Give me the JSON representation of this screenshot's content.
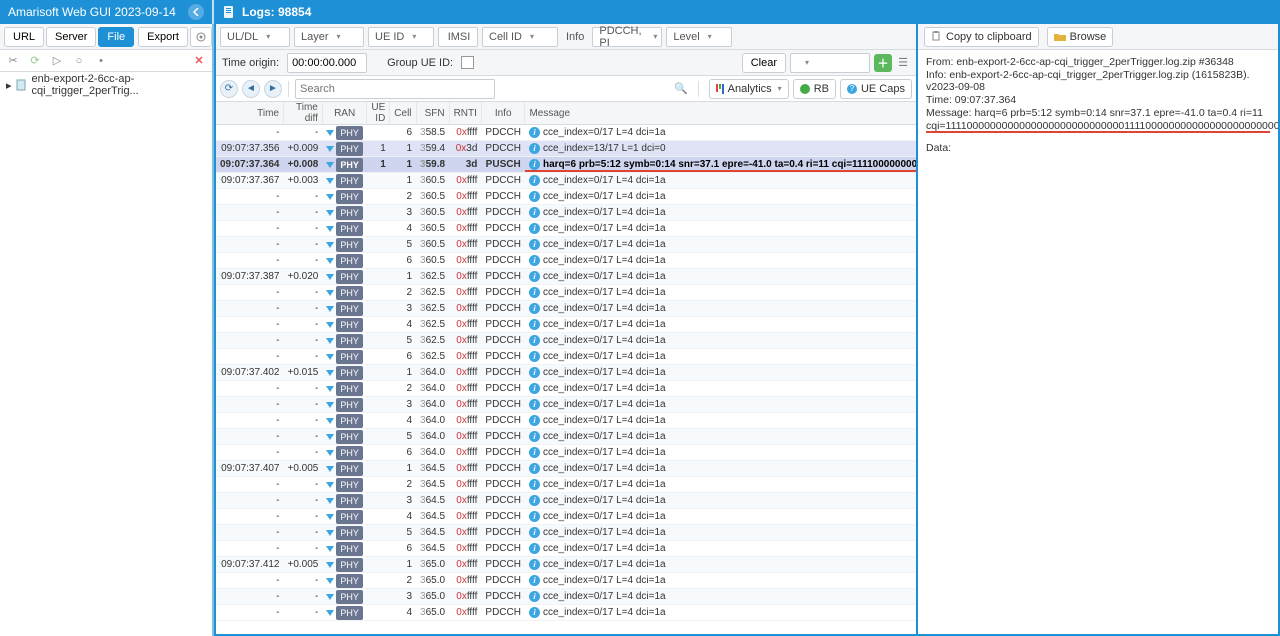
{
  "app_title": "Amarisoft Web GUI 2023-09-14",
  "logs_title": "Logs: 98854",
  "sidebar": {
    "buttons": {
      "url": "URL",
      "server": "Server",
      "file": "File",
      "export": "Export"
    },
    "tree_item": "enb-export-2-6cc-ap-cqi_trigger_2perTrig..."
  },
  "filters": {
    "uldl": "UL/DL",
    "layer": "Layer",
    "ueid": "UE ID",
    "imsi": "IMSI",
    "cellid": "Cell ID",
    "info_label": "Info",
    "info_value": "PDCCH, PI",
    "level": "Level",
    "time_origin_label": "Time origin:",
    "time_origin_value": "00:00:00.000",
    "group_ueid_label": "Group UE ID:",
    "clear": "Clear"
  },
  "actions": {
    "search_placeholder": "Search",
    "analytics": "Analytics",
    "rb": "RB",
    "uecaps": "UE Caps"
  },
  "columns": {
    "time": "Time",
    "tdiff": "Time diff",
    "ran": "RAN",
    "ueid": "UE ID",
    "cell": "Cell",
    "sfn": "SFN",
    "rnti": "RNTI",
    "info": "Info",
    "msg": "Message"
  },
  "detail_toolbar": {
    "copy": "Copy to clipboard",
    "browse": "Browse"
  },
  "detail": {
    "from": "From: enb-export-2-6cc-ap-cqi_trigger_2perTrigger.log.zip #36348",
    "info": "Info: enb-export-2-6cc-ap-cqi_trigger_2perTrigger.log.zip (1615823B). v2023-09-08",
    "time": "Time: 09:07:37.364",
    "message": "Message: harq=6 prb=5:12 symb=0:14 snr=37.1 epre=-41.0 ta=0.4 ri=11",
    "cqi": "cqi=11110000000000000000000000000001111000000000000000000000000000",
    "data": "Data:"
  },
  "ran_label": "PHY",
  "rows": [
    {
      "time": "-",
      "tdiff": "-",
      "ueid": "",
      "cell": "6",
      "sfn": "58.5",
      "rnti": "ffff",
      "rpre": "0x",
      "info": "PDCCH",
      "msg": "cce_index=0/17 L=4 dci=1a",
      "type": "n"
    },
    {
      "time": "09:07:37.356",
      "tdiff": "+0.009",
      "ueid": "1",
      "cell": "1",
      "sfn": "59.4",
      "rnti": "3d",
      "rpre": "0x",
      "info": "PDCCH",
      "msg": "cce_index=13/17 L=1 dci=0",
      "type": "hl1"
    },
    {
      "time": "09:07:37.364",
      "tdiff": "+0.008",
      "ueid": "1",
      "cell": "1",
      "sfn": "59.8",
      "rnti": "3d",
      "rpre": "",
      "info": "PUSCH",
      "msg": "harq=6 prb=5:12 symb=0:14 snr=37.1 epre=-41.0 ta=0.4 ri=11 cqi=1111000000000",
      "type": "hl2"
    },
    {
      "time": "09:07:37.367",
      "tdiff": "+0.003",
      "ueid": "",
      "cell": "1",
      "sfn": "60.5",
      "rnti": "ffff",
      "rpre": "0x",
      "info": "PDCCH",
      "msg": "cce_index=0/17 L=4 dci=1a",
      "type": "n"
    },
    {
      "time": "-",
      "tdiff": "-",
      "ueid": "",
      "cell": "2",
      "sfn": "60.5",
      "rnti": "ffff",
      "rpre": "0x",
      "info": "PDCCH",
      "msg": "cce_index=0/17 L=4 dci=1a",
      "type": "n"
    },
    {
      "time": "-",
      "tdiff": "-",
      "ueid": "",
      "cell": "3",
      "sfn": "60.5",
      "rnti": "ffff",
      "rpre": "0x",
      "info": "PDCCH",
      "msg": "cce_index=0/17 L=4 dci=1a",
      "type": "n"
    },
    {
      "time": "-",
      "tdiff": "-",
      "ueid": "",
      "cell": "4",
      "sfn": "60.5",
      "rnti": "ffff",
      "rpre": "0x",
      "info": "PDCCH",
      "msg": "cce_index=0/17 L=4 dci=1a",
      "type": "n"
    },
    {
      "time": "-",
      "tdiff": "-",
      "ueid": "",
      "cell": "5",
      "sfn": "60.5",
      "rnti": "ffff",
      "rpre": "0x",
      "info": "PDCCH",
      "msg": "cce_index=0/17 L=4 dci=1a",
      "type": "n"
    },
    {
      "time": "-",
      "tdiff": "-",
      "ueid": "",
      "cell": "6",
      "sfn": "60.5",
      "rnti": "ffff",
      "rpre": "0x",
      "info": "PDCCH",
      "msg": "cce_index=0/17 L=4 dci=1a",
      "type": "n"
    },
    {
      "time": "09:07:37.387",
      "tdiff": "+0.020",
      "ueid": "",
      "cell": "1",
      "sfn": "62.5",
      "rnti": "ffff",
      "rpre": "0x",
      "info": "PDCCH",
      "msg": "cce_index=0/17 L=4 dci=1a",
      "type": "n"
    },
    {
      "time": "-",
      "tdiff": "-",
      "ueid": "",
      "cell": "2",
      "sfn": "62.5",
      "rnti": "ffff",
      "rpre": "0x",
      "info": "PDCCH",
      "msg": "cce_index=0/17 L=4 dci=1a",
      "type": "n"
    },
    {
      "time": "-",
      "tdiff": "-",
      "ueid": "",
      "cell": "3",
      "sfn": "62.5",
      "rnti": "ffff",
      "rpre": "0x",
      "info": "PDCCH",
      "msg": "cce_index=0/17 L=4 dci=1a",
      "type": "n"
    },
    {
      "time": "-",
      "tdiff": "-",
      "ueid": "",
      "cell": "4",
      "sfn": "62.5",
      "rnti": "ffff",
      "rpre": "0x",
      "info": "PDCCH",
      "msg": "cce_index=0/17 L=4 dci=1a",
      "type": "n"
    },
    {
      "time": "-",
      "tdiff": "-",
      "ueid": "",
      "cell": "5",
      "sfn": "62.5",
      "rnti": "ffff",
      "rpre": "0x",
      "info": "PDCCH",
      "msg": "cce_index=0/17 L=4 dci=1a",
      "type": "n"
    },
    {
      "time": "-",
      "tdiff": "-",
      "ueid": "",
      "cell": "6",
      "sfn": "62.5",
      "rnti": "ffff",
      "rpre": "0x",
      "info": "PDCCH",
      "msg": "cce_index=0/17 L=4 dci=1a",
      "type": "n"
    },
    {
      "time": "09:07:37.402",
      "tdiff": "+0.015",
      "ueid": "",
      "cell": "1",
      "sfn": "64.0",
      "rnti": "ffff",
      "rpre": "0x",
      "info": "PDCCH",
      "msg": "cce_index=0/17 L=4 dci=1a",
      "type": "n"
    },
    {
      "time": "-",
      "tdiff": "-",
      "ueid": "",
      "cell": "2",
      "sfn": "64.0",
      "rnti": "ffff",
      "rpre": "0x",
      "info": "PDCCH",
      "msg": "cce_index=0/17 L=4 dci=1a",
      "type": "n"
    },
    {
      "time": "-",
      "tdiff": "-",
      "ueid": "",
      "cell": "3",
      "sfn": "64.0",
      "rnti": "ffff",
      "rpre": "0x",
      "info": "PDCCH",
      "msg": "cce_index=0/17 L=4 dci=1a",
      "type": "n"
    },
    {
      "time": "-",
      "tdiff": "-",
      "ueid": "",
      "cell": "4",
      "sfn": "64.0",
      "rnti": "ffff",
      "rpre": "0x",
      "info": "PDCCH",
      "msg": "cce_index=0/17 L=4 dci=1a",
      "type": "n"
    },
    {
      "time": "-",
      "tdiff": "-",
      "ueid": "",
      "cell": "5",
      "sfn": "64.0",
      "rnti": "ffff",
      "rpre": "0x",
      "info": "PDCCH",
      "msg": "cce_index=0/17 L=4 dci=1a",
      "type": "n"
    },
    {
      "time": "-",
      "tdiff": "-",
      "ueid": "",
      "cell": "6",
      "sfn": "64.0",
      "rnti": "ffff",
      "rpre": "0x",
      "info": "PDCCH",
      "msg": "cce_index=0/17 L=4 dci=1a",
      "type": "n"
    },
    {
      "time": "09:07:37.407",
      "tdiff": "+0.005",
      "ueid": "",
      "cell": "1",
      "sfn": "64.5",
      "rnti": "ffff",
      "rpre": "0x",
      "info": "PDCCH",
      "msg": "cce_index=0/17 L=4 dci=1a",
      "type": "n"
    },
    {
      "time": "-",
      "tdiff": "-",
      "ueid": "",
      "cell": "2",
      "sfn": "64.5",
      "rnti": "ffff",
      "rpre": "0x",
      "info": "PDCCH",
      "msg": "cce_index=0/17 L=4 dci=1a",
      "type": "n"
    },
    {
      "time": "-",
      "tdiff": "-",
      "ueid": "",
      "cell": "3",
      "sfn": "64.5",
      "rnti": "ffff",
      "rpre": "0x",
      "info": "PDCCH",
      "msg": "cce_index=0/17 L=4 dci=1a",
      "type": "n"
    },
    {
      "time": "-",
      "tdiff": "-",
      "ueid": "",
      "cell": "4",
      "sfn": "64.5",
      "rnti": "ffff",
      "rpre": "0x",
      "info": "PDCCH",
      "msg": "cce_index=0/17 L=4 dci=1a",
      "type": "n"
    },
    {
      "time": "-",
      "tdiff": "-",
      "ueid": "",
      "cell": "5",
      "sfn": "64.5",
      "rnti": "ffff",
      "rpre": "0x",
      "info": "PDCCH",
      "msg": "cce_index=0/17 L=4 dci=1a",
      "type": "n"
    },
    {
      "time": "-",
      "tdiff": "-",
      "ueid": "",
      "cell": "6",
      "sfn": "64.5",
      "rnti": "ffff",
      "rpre": "0x",
      "info": "PDCCH",
      "msg": "cce_index=0/17 L=4 dci=1a",
      "type": "n"
    },
    {
      "time": "09:07:37.412",
      "tdiff": "+0.005",
      "ueid": "",
      "cell": "1",
      "sfn": "65.0",
      "rnti": "ffff",
      "rpre": "0x",
      "info": "PDCCH",
      "msg": "cce_index=0/17 L=4 dci=1a",
      "type": "n"
    },
    {
      "time": "-",
      "tdiff": "-",
      "ueid": "",
      "cell": "2",
      "sfn": "65.0",
      "rnti": "ffff",
      "rpre": "0x",
      "info": "PDCCH",
      "msg": "cce_index=0/17 L=4 dci=1a",
      "type": "n"
    },
    {
      "time": "-",
      "tdiff": "-",
      "ueid": "",
      "cell": "3",
      "sfn": "65.0",
      "rnti": "ffff",
      "rpre": "0x",
      "info": "PDCCH",
      "msg": "cce_index=0/17 L=4 dci=1a",
      "type": "n"
    },
    {
      "time": "-",
      "tdiff": "-",
      "ueid": "",
      "cell": "4",
      "sfn": "65.0",
      "rnti": "ffff",
      "rpre": "0x",
      "info": "PDCCH",
      "msg": "cce_index=0/17 L=4 dci=1a",
      "type": "n"
    }
  ]
}
